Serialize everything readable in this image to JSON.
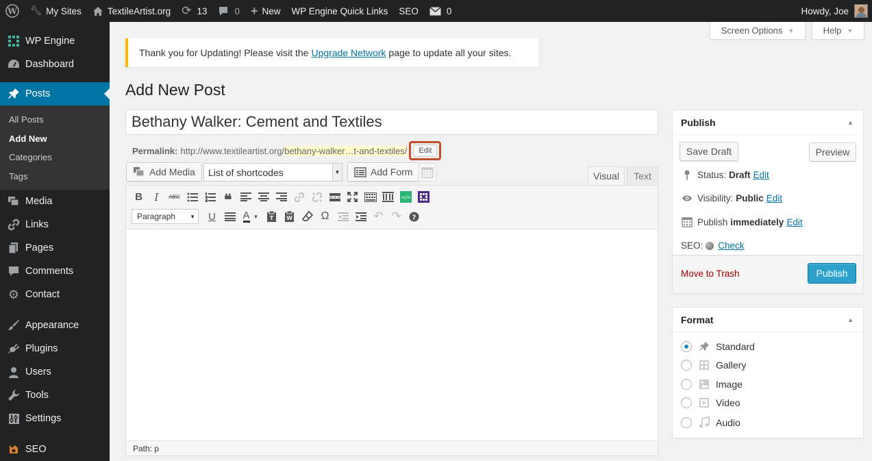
{
  "admin_bar": {
    "my_sites": "My Sites",
    "site_name": "TextileArtist.org",
    "updates_count": "13",
    "comments_count": "0",
    "new_label": "New",
    "quick_links": "WP Engine Quick Links",
    "seo": "SEO",
    "mail_count": "0",
    "howdy": "Howdy, Joe"
  },
  "menu": {
    "wp_engine": "WP Engine",
    "dashboard": "Dashboard",
    "posts": "Posts",
    "posts_sub": [
      "All Posts",
      "Add New",
      "Categories",
      "Tags"
    ],
    "media": "Media",
    "links": "Links",
    "pages": "Pages",
    "comments": "Comments",
    "contact": "Contact",
    "appearance": "Appearance",
    "plugins": "Plugins",
    "users": "Users",
    "tools": "Tools",
    "settings": "Settings",
    "seo": "SEO"
  },
  "screen_options": "Screen Options",
  "help": "Help",
  "notice": {
    "before": "Thank you for Updating! Please visit the",
    "link": "Upgrade Network",
    "after": "page to update all your sites."
  },
  "page_title": "Add New Post",
  "post_title": "Bethany Walker: Cement and Textiles",
  "permalink": {
    "label": "Permalink:",
    "base": "http://www.textileartist.org/",
    "slug": "bethany-walker…t-and-textiles/",
    "edit": "Edit"
  },
  "editor": {
    "add_media": "Add Media",
    "shortcodes": "List of shortcodes",
    "add_form": "Add Form",
    "tab_visual": "Visual",
    "tab_text": "Text",
    "format_select": "Paragraph",
    "path": "Path: p"
  },
  "publish": {
    "title": "Publish",
    "save_draft": "Save Draft",
    "preview": "Preview",
    "status_label": "Status:",
    "status_value": "Draft",
    "visibility_label": "Visibility:",
    "visibility_value": "Public",
    "publish_label": "Publish",
    "publish_value": "immediately",
    "edit": "Edit",
    "seo_label": "SEO:",
    "seo_check": "Check",
    "move_to_trash": "Move to Trash",
    "publish_button": "Publish"
  },
  "format": {
    "title": "Format",
    "options": [
      "Standard",
      "Gallery",
      "Image",
      "Video",
      "Audio"
    ],
    "selected": "Standard"
  },
  "colors": {
    "admin_bar": "#222222",
    "active_menu": "#0074a2",
    "publish_button": "#2ea2cc",
    "notice_border": "#ffba00",
    "trash": "#aa0000",
    "highlight": "#c0502a"
  }
}
